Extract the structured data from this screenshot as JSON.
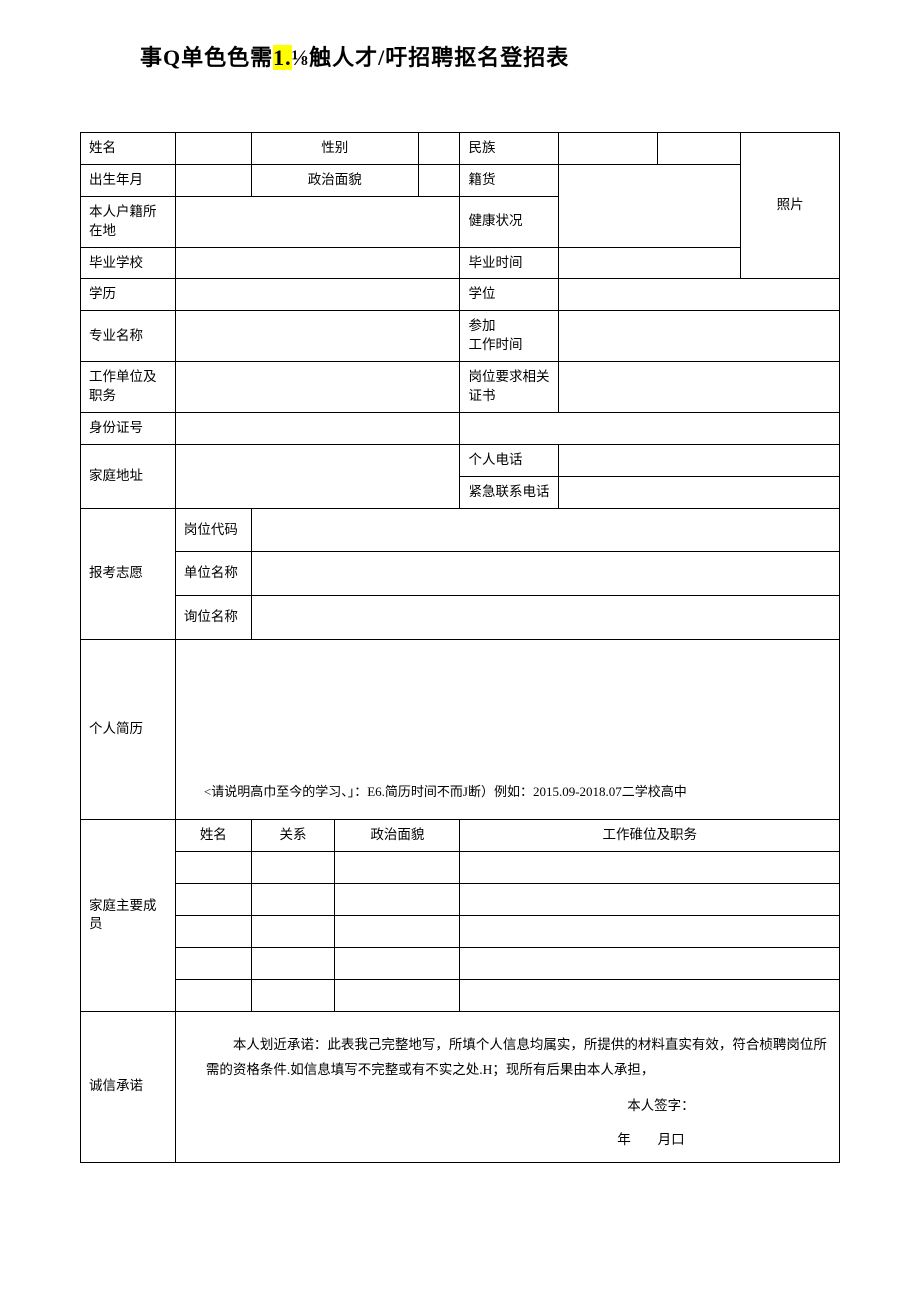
{
  "title_pre": "事Q单色色需",
  "title_hl": "1.",
  "title_post": "⅛触人才/吁招聘抠名登招表",
  "labels": {
    "name": "姓名",
    "gender": "性别",
    "ethnic": "民族",
    "birth": "出生年月",
    "politic": "政治面貌",
    "huo": "籍货",
    "hukou": "本人户籍所在地",
    "health": "健康状况",
    "grad_school": "毕业学校",
    "grad_time": "毕业时间",
    "edu": "学历",
    "degree": "学位",
    "major": "专业名称",
    "work_start": "参加\n工作时间",
    "work_unit": "工作单位及职务",
    "cert": "岗位要求相关证书",
    "idno": "身份证号",
    "addr": "家庭地址",
    "phone": "个人电话",
    "emerg": "紧急联系电话",
    "apply": "报考志愿",
    "post_code": "岗位代码",
    "unit_name": "单位名称",
    "post_name": "询位名称",
    "resume": "个人简历",
    "family": "家庭主要成员",
    "fam_name": "姓名",
    "fam_rel": "关系",
    "fam_pol": "政治面貌",
    "fam_work": "工作碓位及职务",
    "pledge": "诚信承诺",
    "photo": "照片"
  },
  "resume_note": "<请说明高巾至今的学习、」：E6.简历时间不而J断）例如：2015.09-2018.07二学校高中",
  "pledge_text": "本人划近承诺：此表我己完整地写，所填个人信息均属实，所提供的材料直实有效，符合桢聘岗位所需的资格条件.如信息填写不完整或有不实之处.H；现所有后果由本人承担，",
  "sign_label": "本人签字：",
  "date_label": "年　　月口"
}
